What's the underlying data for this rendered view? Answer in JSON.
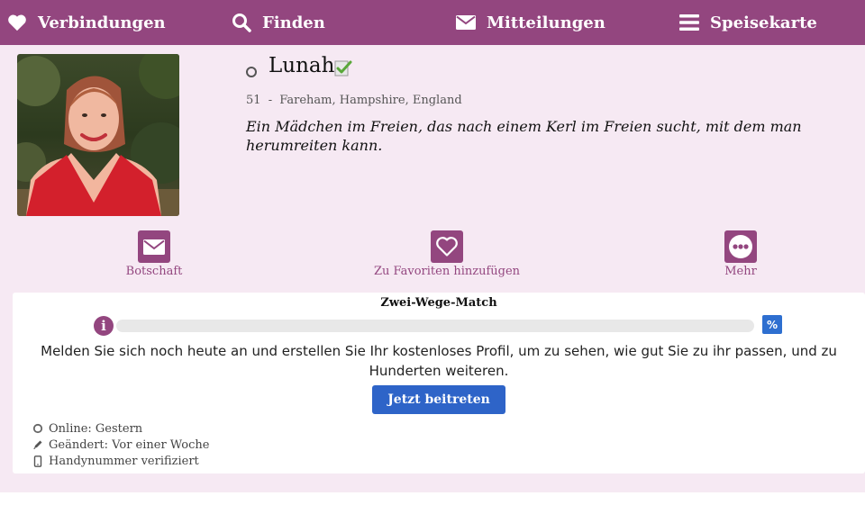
{
  "nav": {
    "items": [
      {
        "label": "Verbindungen",
        "icon": "heart-icon"
      },
      {
        "label": "Finden",
        "icon": "search-icon"
      },
      {
        "label": "Mitteilungen",
        "icon": "envelope-icon"
      },
      {
        "label": "Speisekarte",
        "icon": "hamburger-menu-icon"
      }
    ]
  },
  "profile": {
    "name": "Lunah",
    "age": "51",
    "separator": "-",
    "location": "Fareham, Hampshire, England",
    "tagline": "Ein Mädchen im Freien, das nach einem Kerl im Freien sucht, mit dem man herumreiten kann.",
    "photo_icon": "profile-photo"
  },
  "actions": {
    "message": "Botschaft",
    "favorite": "Zu Favoriten hinzufügen",
    "more": "Mehr"
  },
  "match": {
    "title": "Zwei-Wege-Match",
    "percent_symbol": "%",
    "progress": 0,
    "cta_text": "Melden Sie sich noch heute an und erstellen Sie Ihr kostenloses Profil, um zu sehen, wie gut Sie zu ihr passen, und zu Hunderten weiteren.",
    "join_button": "Jetzt beitreten"
  },
  "facts": [
    {
      "icon": "online-status-icon",
      "text": "Online: Gestern"
    },
    {
      "icon": "pencil-icon",
      "text": "Geändert: Vor einer Woche"
    },
    {
      "icon": "phone-icon",
      "text": "Handynummer verifiziert"
    }
  ],
  "colors": {
    "brand": "#93467f",
    "profile_bg": "#f6e9f3",
    "button_blue": "#2e64c8",
    "verified_green": "#5aa83a"
  }
}
